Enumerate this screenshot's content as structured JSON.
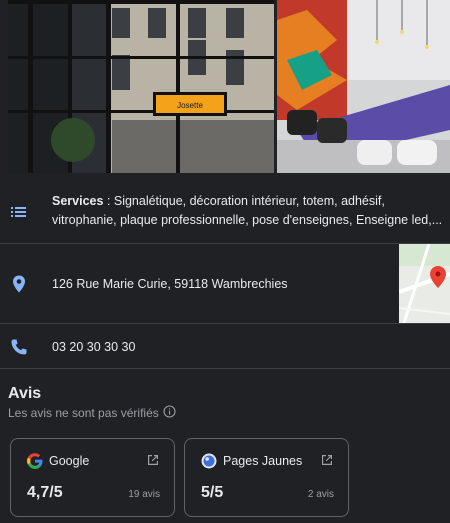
{
  "photos": {
    "left_sign": "Josette"
  },
  "services": {
    "label": "Services",
    "line1": " : Signalétique, décoration intérieur, totem, adhésif,",
    "line2": "vitrophanie, plaque professionnelle, pose d'enseignes, Enseigne led,...",
    "icon": "list-icon"
  },
  "address": {
    "text": "126 Rue Marie Curie, 59118 Wambrechies",
    "icon": "location-pin-icon"
  },
  "phone": {
    "text": "03 20 30 30 30",
    "icon": "phone-icon"
  },
  "reviews": {
    "title": "Avis",
    "subtitle": "Les avis ne sont pas vérifiés",
    "cards": [
      {
        "name": "Google",
        "score": "4,7/5",
        "count": "19 avis"
      },
      {
        "name": "Pages Jaunes",
        "score": "5/5",
        "count": "2 avis"
      }
    ]
  },
  "colors": {
    "background": "#202124",
    "icon_blue": "#8ab4f8",
    "text_primary": "#e8eaed",
    "text_secondary": "#9aa0a6",
    "map_pin": "#ea4335"
  }
}
